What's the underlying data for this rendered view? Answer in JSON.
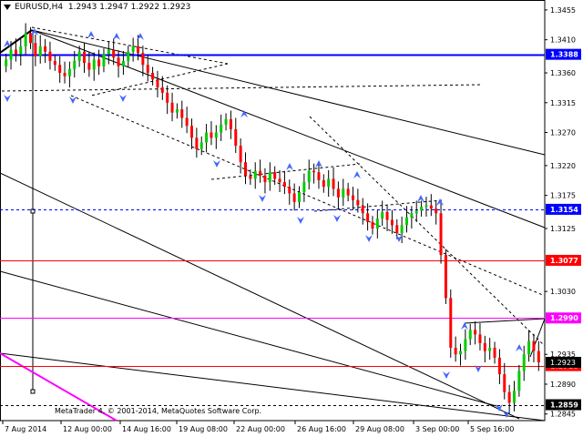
{
  "header": {
    "symbol": "EURUSD,H4",
    "ohlc": "1.2943 1.2947 1.2922 1.2923"
  },
  "footer": {
    "copyright": "MetaTrader 4, © 2001-2014, MetaQuotes Software Corp."
  },
  "colors": {
    "bull": "#00cc00",
    "bear": "#ff0000",
    "blue_level": "#0000ff",
    "red_level": "#ff0000",
    "magenta_level": "#ff00ff",
    "fractal": "#4466ff"
  },
  "chart_data": {
    "type": "candlestick",
    "symbol": "EURUSD",
    "timeframe": "H4",
    "x_tick_labels": [
      "7 Aug 2014",
      "12 Aug 00:00",
      "14 Aug 16:00",
      "19 Aug 08:00",
      "22 Aug 00:00",
      "26 Aug 16:00",
      "29 Aug 08:00",
      "3 Sep 00:00",
      "5 Sep 16:00"
    ],
    "y_tick_labels": [
      "1.3455",
      "1.3410",
      "1.3360",
      "1.3315",
      "1.3270",
      "1.3220",
      "1.3175",
      "1.3125",
      "1.3030",
      "1.2935",
      "1.2890",
      "1.2845"
    ],
    "ylim": [
      1.2835,
      1.347
    ],
    "levels": [
      {
        "value": "1.3388",
        "color": "blue",
        "style": "solid"
      },
      {
        "value": "1.3154",
        "color": "blue",
        "style": "dashed"
      },
      {
        "value": "1.3077",
        "color": "red",
        "style": "solid"
      },
      {
        "value": "1.2990",
        "color": "magenta",
        "style": "solid"
      },
      {
        "value": "1.2918",
        "color": "red",
        "style": "solid"
      },
      {
        "value": "1.2859",
        "color": "black",
        "style": "dashed"
      }
    ],
    "current_price": "1.2923",
    "closes": [
      1.338,
      1.3395,
      1.3388,
      1.34,
      1.342,
      1.3405,
      1.3385,
      1.34,
      1.3392,
      1.3378,
      1.3372,
      1.336,
      1.3355,
      1.3366,
      1.3378,
      1.3392,
      1.3375,
      1.3365,
      1.338,
      1.337,
      1.3388,
      1.3395,
      1.3383,
      1.337,
      1.3378,
      1.3392,
      1.34,
      1.339,
      1.3372,
      1.336,
      1.335,
      1.3338,
      1.333,
      1.3315,
      1.33,
      1.3305,
      1.3292,
      1.328,
      1.3262,
      1.3245,
      1.3255,
      1.327,
      1.3262,
      1.327,
      1.3282,
      1.329,
      1.3275,
      1.325,
      1.3225,
      1.3205,
      1.32,
      1.3212,
      1.3205,
      1.3195,
      1.321,
      1.32,
      1.3195,
      1.3188,
      1.3178,
      1.3165,
      1.318,
      1.3195,
      1.3212,
      1.321,
      1.3198,
      1.3188,
      1.32,
      1.3185,
      1.3172,
      1.3185,
      1.3175,
      1.3168,
      1.316,
      1.3148,
      1.3135,
      1.3125,
      1.314,
      1.315,
      1.3138,
      1.313,
      1.3118,
      1.313,
      1.3142,
      1.3148,
      1.3152,
      1.3158,
      1.316,
      1.3155,
      1.3148,
      1.3085,
      1.302,
      1.2945,
      1.2935,
      1.294,
      1.2958,
      1.2972,
      1.2965,
      1.2952,
      1.294,
      1.2945,
      1.293,
      1.2905,
      1.2878,
      1.2862,
      1.288,
      1.291,
      1.2935,
      1.2955,
      1.294,
      1.2923
    ]
  }
}
